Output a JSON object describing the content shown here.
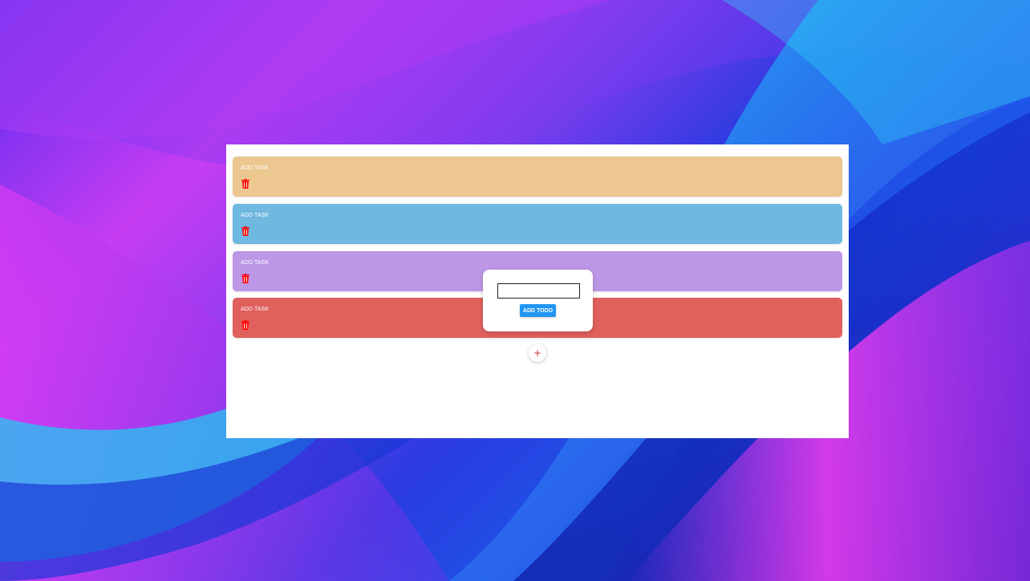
{
  "colors": {
    "card_orange": "#ecc78f",
    "card_blue": "#6fb8e0",
    "card_purple": "#bc97e6",
    "card_red": "#e0605e",
    "trash_red": "#ff0000",
    "button_blue": "#2196f3",
    "fab_plus": "#c0392b"
  },
  "tasks": [
    {
      "label": "ADD TASK",
      "color_key": "card_orange",
      "delete_icon": "trash-icon"
    },
    {
      "label": "ADD TASK",
      "color_key": "card_blue",
      "delete_icon": "trash-icon"
    },
    {
      "label": "ADD TASK",
      "color_key": "card_purple",
      "delete_icon": "trash-icon"
    },
    {
      "label": "ADD TASK",
      "color_key": "card_red",
      "delete_icon": "trash-icon"
    }
  ],
  "popup": {
    "input_value": "",
    "button_label": "ADD TODO"
  },
  "fab": {
    "label": "+",
    "icon": "plus-icon"
  }
}
